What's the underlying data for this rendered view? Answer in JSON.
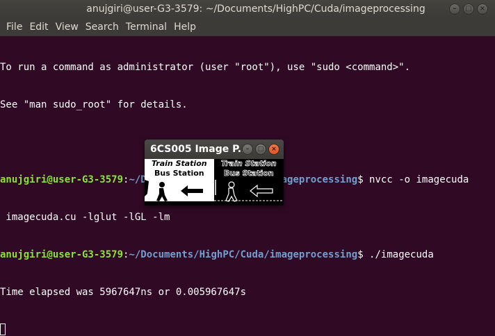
{
  "window": {
    "title": "anujgiri@user-G3-3579: ~/Documents/HighPC/Cuda/imageprocessing",
    "buttons": [
      "–",
      "□",
      "×"
    ]
  },
  "menu": [
    "File",
    "Edit",
    "View",
    "Search",
    "Terminal",
    "Help"
  ],
  "terminal": {
    "intro_line1": "To run a command as administrator (user \"root\"), use \"sudo <command>\".",
    "intro_line2": "See \"man sudo_root\" for details.",
    "prompt_user": "anujgiri@user-G3-3579",
    "prompt_sep": ":",
    "prompt_path": "~/Documents/HighPC/Cuda/imageprocessing",
    "prompt_end": "$ ",
    "cmd1": "nvcc -o imagecuda",
    "cmd1_wrap": " imagecuda.cu -lglut -lGL -lm",
    "cmd2": "./imagecuda",
    "output": "Time elapsed was 5967647ns or 0.005967647s"
  },
  "image_window": {
    "title": "6CS005 Image P...",
    "buttons": [
      "–",
      "□",
      "×"
    ],
    "sign_line1": "Train Station",
    "sign_line2": "Bus Station"
  },
  "colors": {
    "background": "#300a24",
    "prompt_user": "#8ae234",
    "prompt_path": "#729fcf"
  }
}
